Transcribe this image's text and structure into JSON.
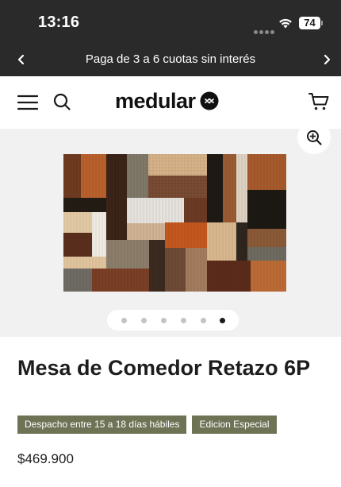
{
  "status_bar": {
    "time": "13:16",
    "battery": "74"
  },
  "promo": {
    "text": "Paga de 3 a 6 cuotas sin interés"
  },
  "header": {
    "brand": "medular"
  },
  "gallery": {
    "image_count": 6,
    "active_index": 5
  },
  "product": {
    "title": "Mesa de Comedor Retazo 6P",
    "badges": [
      "Despacho entre 15 a 18 días hábiles",
      "Edicion Especial"
    ],
    "price": "$469.900"
  },
  "colors": {
    "dark_bar": "#2a2a2a",
    "badge_bg": "#6f7356",
    "gallery_bg": "#f1f1f1"
  },
  "icons": [
    "wifi-icon",
    "battery-icon",
    "chevron-left-icon",
    "chevron-right-icon",
    "menu-icon",
    "search-icon",
    "cart-icon",
    "zoom-in-icon"
  ]
}
